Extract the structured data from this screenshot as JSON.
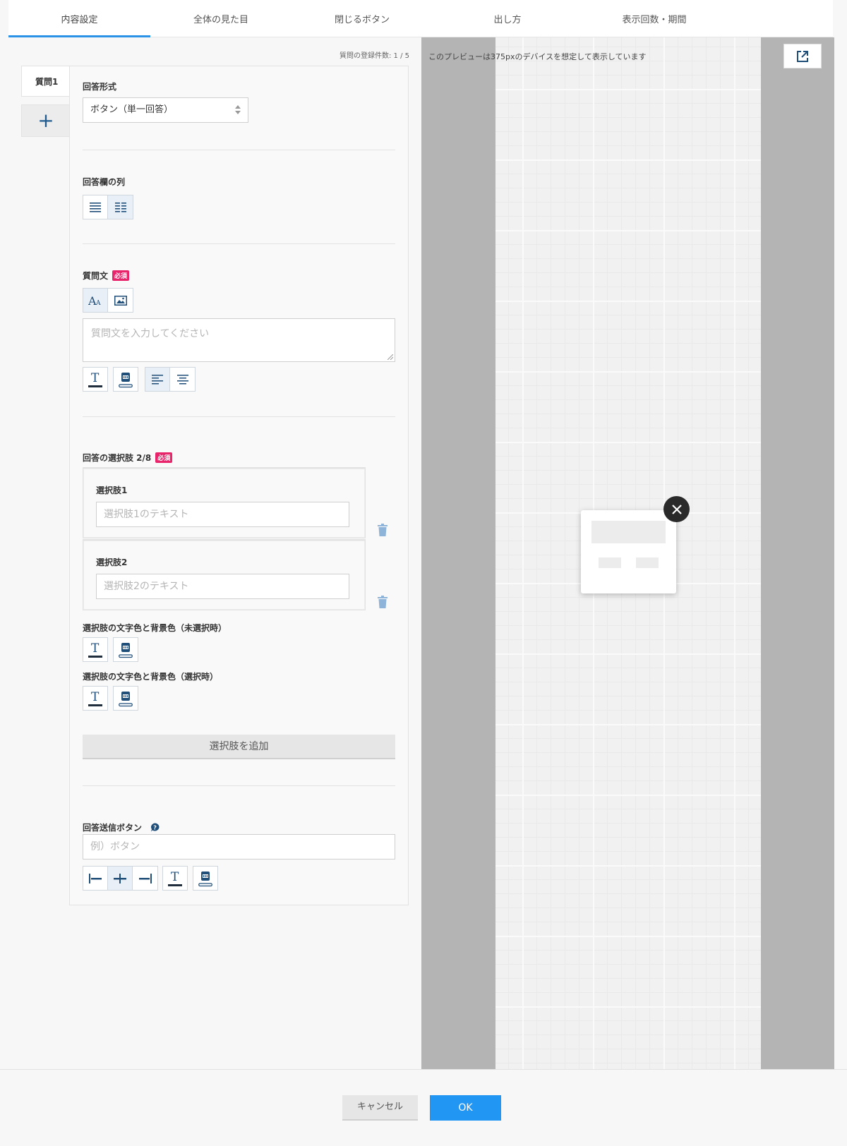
{
  "tabs": [
    "内容設定",
    "全体の見た目",
    "閉じるボタン",
    "出し方",
    "表示回数・期間"
  ],
  "registration_count": "質問の登録件数: 1 / 5",
  "question_tab": "質問1",
  "add_question_icon": "plus-icon",
  "answer_format": {
    "label": "回答形式",
    "value": "ボタン（単一回答）"
  },
  "answer_columns": {
    "label": "回答欄の列"
  },
  "question_text": {
    "label": "質問文",
    "required_badge": "必須",
    "placeholder": "質問文を入力してください"
  },
  "choices": {
    "label": "回答の選択肢 2/8",
    "required_badge": "必須",
    "items": [
      {
        "label": "選択肢1",
        "placeholder": "選択肢1のテキスト"
      },
      {
        "label": "選択肢2",
        "placeholder": "選択肢2のテキスト"
      }
    ],
    "unselected_colors_label": "選択肢の文字色と背景色（未選択時）",
    "selected_colors_label": "選択肢の文字色と背景色（選択時）",
    "add_button": "選択肢を追加"
  },
  "submit_button": {
    "label": "回答送信ボタン",
    "placeholder": "例）ボタン"
  },
  "preview": {
    "note": "このプレビューは375pxのデバイスを想定して表示しています"
  },
  "footer": {
    "cancel": "キャンセル",
    "ok": "OK"
  },
  "colors": {
    "accent": "#2196f3",
    "required": "#e8246b",
    "icon": "#1f4e79"
  }
}
